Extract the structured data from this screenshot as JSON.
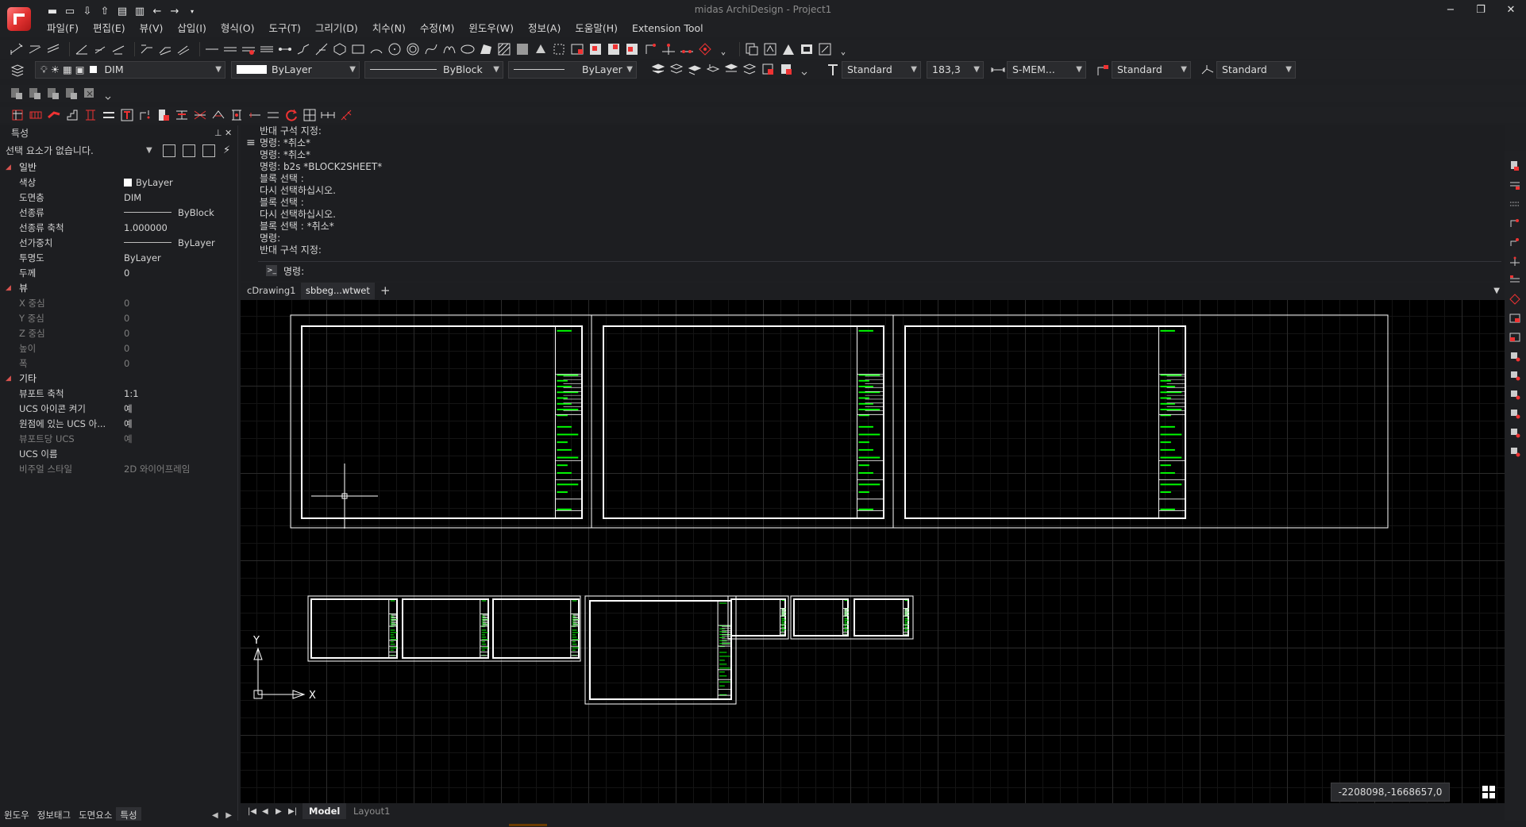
{
  "app": {
    "title": "midas ArchiDesign - Project1",
    "window_controls": [
      "−",
      "❐",
      "✕"
    ]
  },
  "menu": [
    "파일(F)",
    "편집(E)",
    "뷰(V)",
    "삽입(I)",
    "형식(O)",
    "도구(T)",
    "그리기(D)",
    "치수(N)",
    "수정(M)",
    "윈도우(W)",
    "정보(A)",
    "도움말(H)",
    "Extension Tool"
  ],
  "toolbar": {
    "layer": "DIM",
    "color": "ByLayer",
    "linetype": "ByBlock",
    "lineweight": "ByLayer",
    "text_style": "Standard",
    "text_height": "183,3",
    "dim_style": "S-MEM...",
    "leader_style": "Standard",
    "table_style": "Standard"
  },
  "properties": {
    "header": "특성",
    "selection": "선택 요소가 없습니다.",
    "categories": [
      {
        "name": "일반",
        "rows": [
          {
            "label": "색상",
            "value": "ByLayer",
            "kind": "color",
            "dim": false
          },
          {
            "label": "도면층",
            "value": "DIM",
            "kind": "text",
            "dim": false
          },
          {
            "label": "선종류",
            "value": "ByBlock",
            "kind": "line",
            "dim": false
          },
          {
            "label": "선종류 축척",
            "value": "1.000000",
            "kind": "text",
            "dim": false
          },
          {
            "label": "선가중치",
            "value": "ByLayer",
            "kind": "line",
            "dim": false
          },
          {
            "label": "투명도",
            "value": "ByLayer",
            "kind": "text",
            "dim": false
          },
          {
            "label": "두께",
            "value": "0",
            "kind": "text",
            "dim": false
          }
        ]
      },
      {
        "name": "뷰",
        "rows": [
          {
            "label": "X 중심",
            "value": "0",
            "kind": "text",
            "dim": true
          },
          {
            "label": "Y 중심",
            "value": "0",
            "kind": "text",
            "dim": true
          },
          {
            "label": "Z 중심",
            "value": "0",
            "kind": "text",
            "dim": true
          },
          {
            "label": "높이",
            "value": "0",
            "kind": "text",
            "dim": true
          },
          {
            "label": "폭",
            "value": "0",
            "kind": "text",
            "dim": true
          }
        ]
      },
      {
        "name": "기타",
        "rows": [
          {
            "label": "뷰포트 축척",
            "value": "1:1",
            "kind": "text",
            "dim": false
          },
          {
            "label": "UCS 아이콘 켜기",
            "value": "예",
            "kind": "text",
            "dim": false
          },
          {
            "label": "원점에 있는 UCS 아...",
            "value": "예",
            "kind": "text",
            "dim": false
          },
          {
            "label": "뷰포트당 UCS",
            "value": "예",
            "kind": "text",
            "dim": true
          },
          {
            "label": "UCS 이름",
            "value": "",
            "kind": "text",
            "dim": false
          },
          {
            "label": "비주얼 스타일",
            "value": "2D 와이어프레임",
            "kind": "text",
            "dim": true
          }
        ]
      }
    ]
  },
  "panel_tabs": [
    "윈도우",
    "정보태그",
    "도면요소",
    "특성"
  ],
  "command": {
    "lines": [
      "반대 구석 지정:",
      "명령: *취소*",
      "명령: *취소*",
      "명령: b2s *BLOCK2SHEET*",
      "블록 선택 :",
      "다시 선택하십시오.",
      "블록 선택 :",
      "다시 선택하십시오.",
      "블록 선택 : *취소*",
      "명령:",
      "반대 구석 지정:"
    ],
    "prompt": "명령:"
  },
  "doc_tabs": [
    "cDrawing1",
    "sbbeg...wtwet"
  ],
  "layout_tabs": [
    "Model",
    "Layout1"
  ],
  "coordinates": "-2208098,-1668657,0",
  "ucs": {
    "x": "X",
    "y": "Y"
  },
  "colors": {
    "accent": "#d9534f",
    "drawing_line": "#ffffff",
    "title_block": "#00ff00"
  }
}
